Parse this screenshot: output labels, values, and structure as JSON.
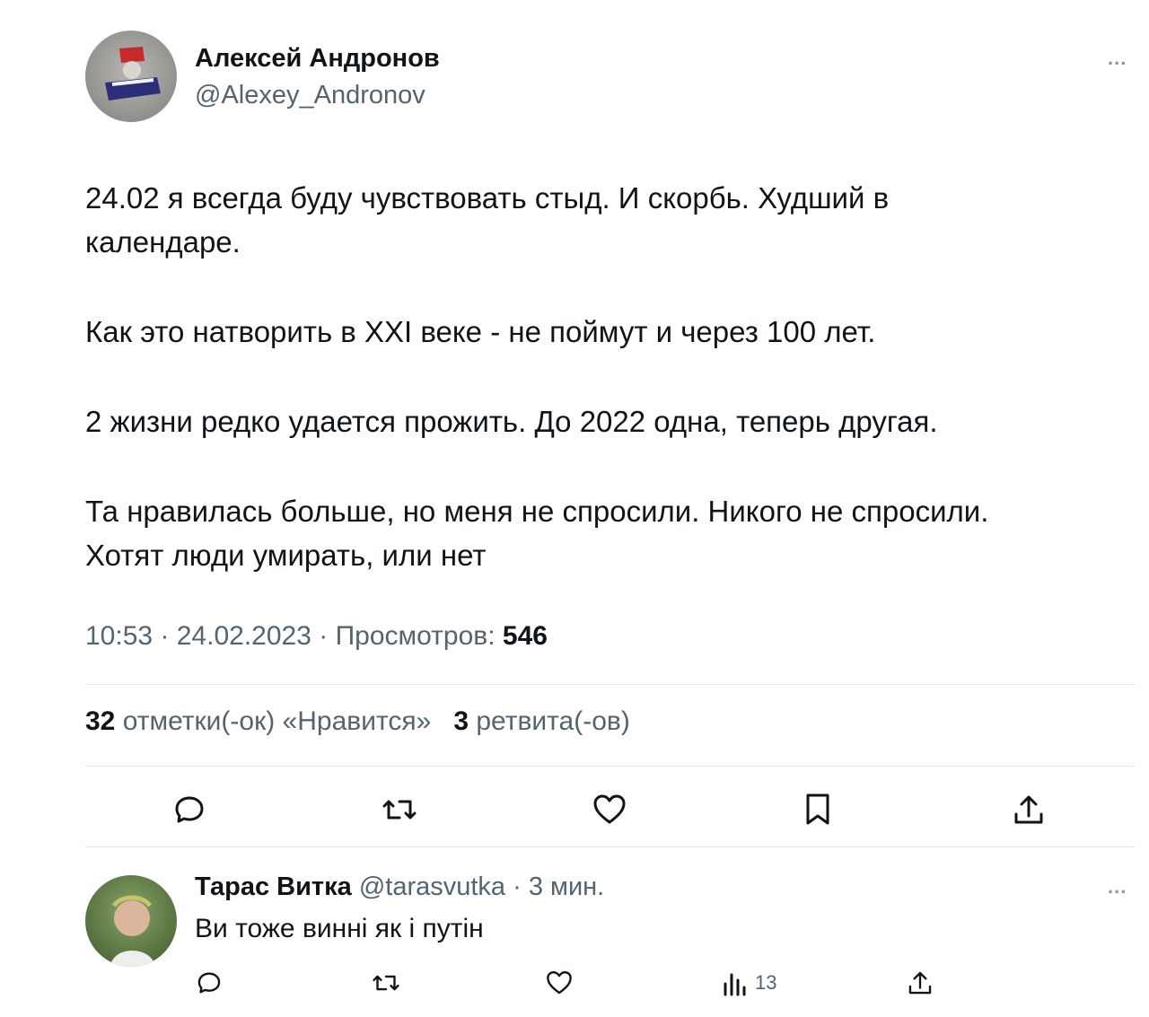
{
  "tweet": {
    "author_name": "Алексей Андронов",
    "author_handle": "@Alexey_Andronov",
    "more": "...",
    "paragraphs": [
      "24.02 я всегда буду чувствовать стыд. И скорбь. Худший в\nкалендаре.",
      "Как это натворить в XXI веке - не поймут и через 100 лет.",
      "2 жизни редко удается прожить. До 2022 одна, теперь другая.",
      "Та нравилась больше, но меня не спросили. Никого не спросили.\nХотят люди умирать, или нет"
    ],
    "time": "10:53",
    "date": "24.02.2023",
    "views_label": "Просмотров:",
    "views_count": "546",
    "likes_count": "32",
    "likes_label": "отметки(-ок) «Нравится»",
    "retweets_count": "3",
    "retweets_label": "ретвита(-ов)",
    "actions": [
      "reply-icon",
      "retweet-icon",
      "like-icon",
      "bookmark-icon",
      "share-icon"
    ]
  },
  "reply": {
    "author_name": "Тарас Витка",
    "author_handle": "@tarasvutka",
    "time_ago": "3 мин.",
    "more": "...",
    "text": "Ви тоже винні як і путін",
    "views_count": "13",
    "actions": [
      "reply-icon",
      "retweet-icon",
      "like-icon",
      "views-icon",
      "share-icon"
    ]
  },
  "colors": {
    "text": "#0f1419",
    "secondary": "#536471",
    "divider": "#e4e8eb"
  }
}
